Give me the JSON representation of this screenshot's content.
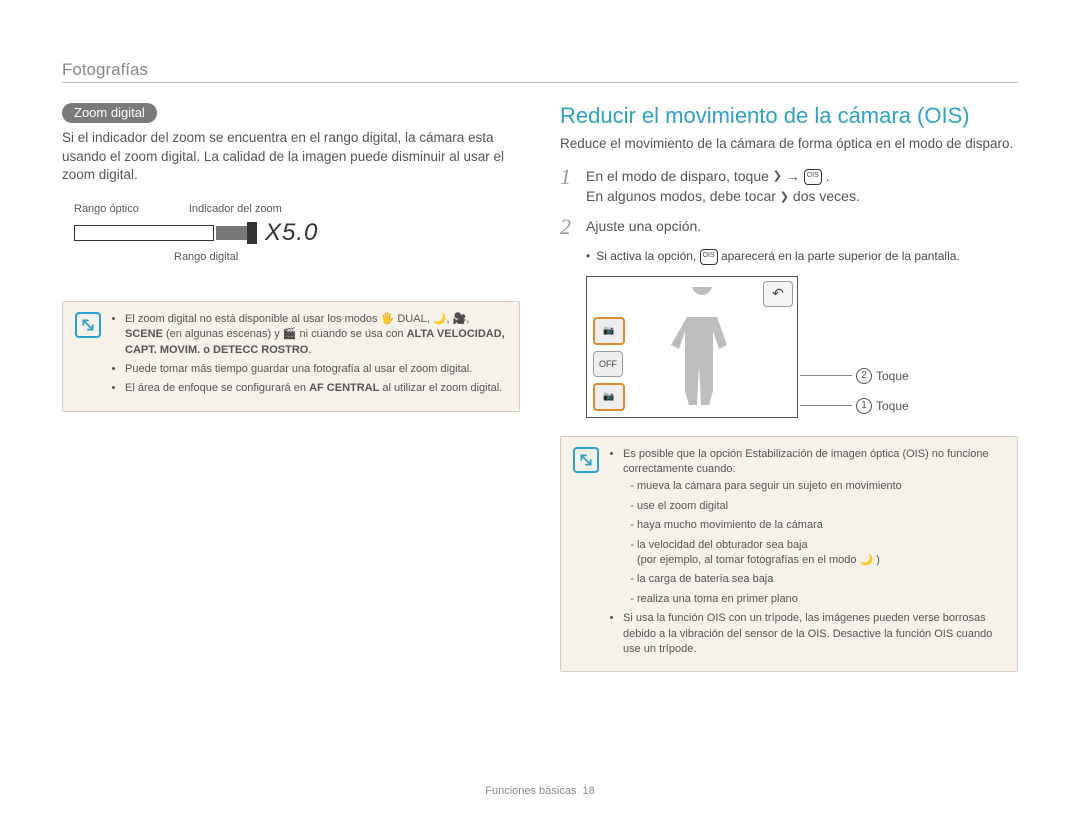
{
  "header": {
    "breadcrumb": "Fotografías"
  },
  "left": {
    "pill": "Zoom digital",
    "intro": "Si el indicador del zoom se encuentra en el rango digital, la cámara esta usando el zoom digital. La calidad de la imagen puede disminuir al usar el zoom digital.",
    "diagram": {
      "optical_label": "Rango óptico",
      "indicator_label": "Indicador del zoom",
      "digital_label": "Rango digital",
      "zoom_value": "X5.0"
    },
    "note": {
      "b1_a": "El zoom digital no está disponible al usar los modos ",
      "b1_icons": "🖐 DUAL, 🌙, 🎥,",
      "b1_b": " (en algunas escenas) y ",
      "b1_c": " ni cuando se usa con ",
      "b1_scene": "SCENE",
      "b1_bold": "ALTA VELOCIDAD, CAPT. MOVIM. o DETECC ROSTRO",
      "b2": "Puede tomar más tiempo guardar una fotografía al usar el zoom digital.",
      "b3_a": "El área de enfoque se configurará en ",
      "b3_bold": "AF CENTRAL",
      "b3_b": " al utilizar el zoom digital."
    }
  },
  "right": {
    "title": "Reducir el movimiento de la cámara (OIS)",
    "intro": "Reduce el movimiento de la cámara de forma óptica en el modo de disparo.",
    "step1_a": "En el modo de disparo, toque ",
    "step1_b": " → ",
    "step1_c": ".",
    "step1_note_a": "En algunos modos, debe tocar ",
    "step1_note_b": " dos veces.",
    "step2": "Ajuste una opción.",
    "step2_sub_a": "Si activa la opción, ",
    "step2_sub_b": " aparecerá en la parte superior de la pantalla.",
    "callout2": "Toque",
    "callout1": "Toque",
    "circled1": "1",
    "circled2": "2",
    "note": {
      "b1": "Es posible que la opción Estabilización de imagen óptica (OIS) no funcione correctamente cuando:",
      "s1": "mueva la cámara para seguir un sujeto en movimiento",
      "s2": "use el zoom digital",
      "s3": "haya mucho movimiento de la cámara",
      "s4": "la velocidad del obturador sea baja",
      "s4b": "(por ejemplo, al tomar fotografías en el modo 🌙 )",
      "s5": "la carga de batería sea baja",
      "s6": "realiza una toma en primer plano",
      "b2": "Si usa la función OIS con un trípode, las imágenes pueden verse borrosas debido a la vibración del sensor de la OIS. Desactive la función OIS cuando use un trípode."
    }
  },
  "footer": {
    "section": "Funciones básicas",
    "page": "18"
  }
}
